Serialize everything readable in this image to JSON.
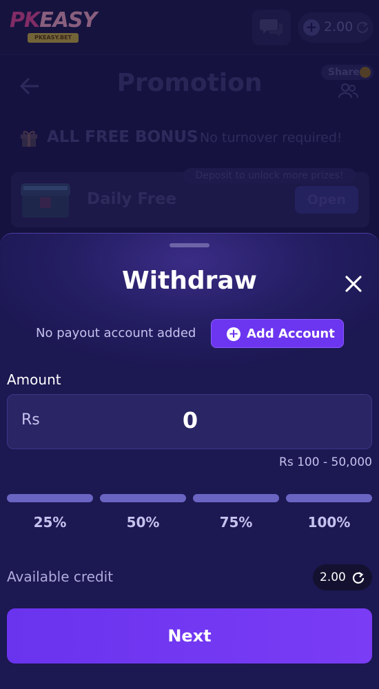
{
  "topbar": {
    "logo_text_pk": "PK",
    "logo_text_easy": "EASY",
    "logo_ribbon": "PKEASY.BET",
    "balance": "2.00"
  },
  "promo": {
    "title": "Promotion",
    "share_label": "Share",
    "bonus_title": "ALL FREE BONUS",
    "bonus_subtitle": "No turnover required!",
    "daily_note": "Deposit to unlock more prizes!",
    "daily_label": "Daily Free",
    "open_label": "Open"
  },
  "withdraw": {
    "title": "Withdraw",
    "payout_text": "No payout account added",
    "add_account_label": "Add Account",
    "amount_label": "Amount",
    "currency": "Rs",
    "amount_value": "0",
    "range_text": "Rs 100 - 50,000",
    "percent_options": [
      "25%",
      "50%",
      "75%",
      "100%"
    ],
    "credit_label": "Available credit",
    "credit_value": "2.00",
    "next_label": "Next"
  },
  "colors": {
    "accent": "#6c35f0",
    "background": "#1c1852",
    "bar": "#6a64c2"
  }
}
